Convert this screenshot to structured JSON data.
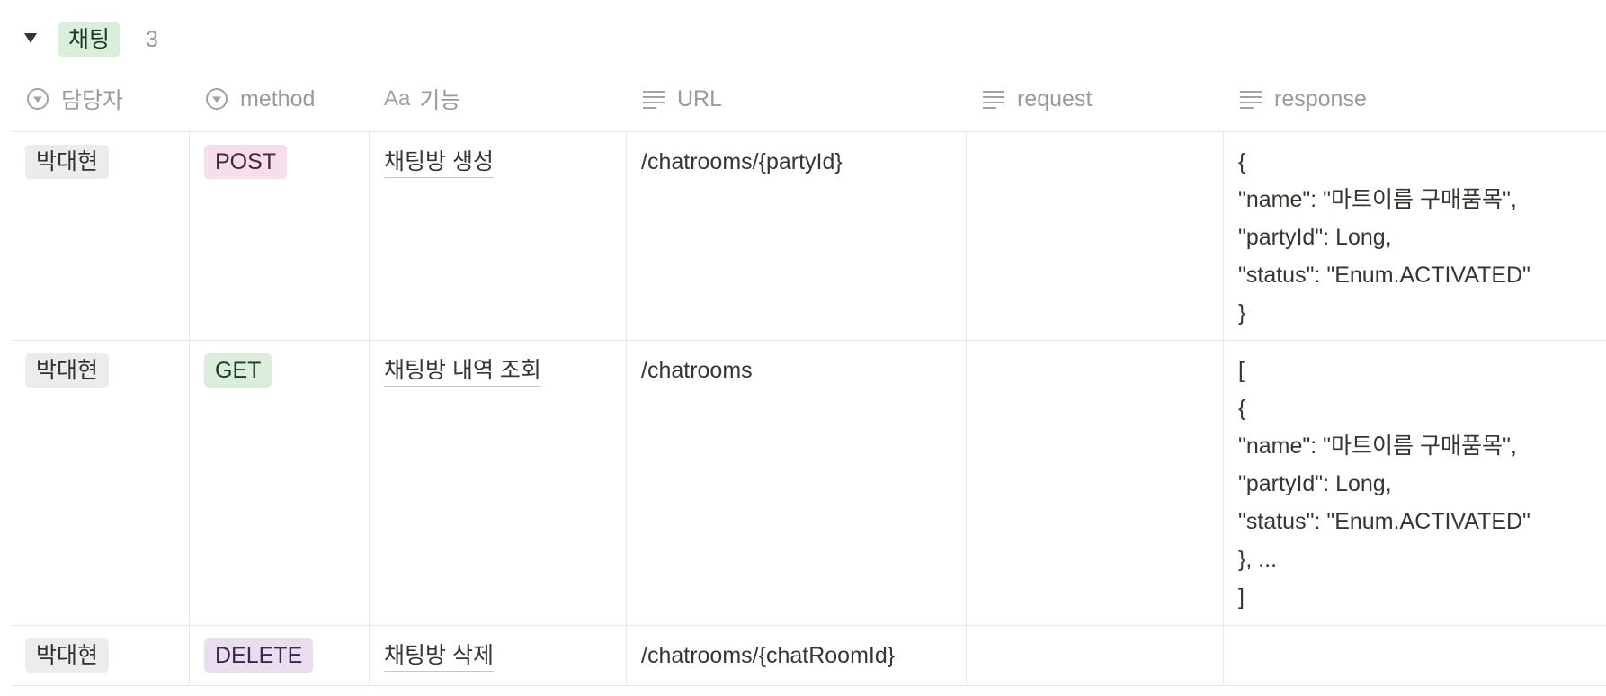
{
  "group": {
    "toggle_icon": "triangle-down-icon",
    "label": "채팅",
    "count": "3",
    "chip_color": "#dbeddb"
  },
  "columns": [
    {
      "label": "담당자",
      "icon": "select-icon"
    },
    {
      "label": "method",
      "icon": "select-icon"
    },
    {
      "label": "기능",
      "icon": "title-icon",
      "icon_text": "Aa"
    },
    {
      "label": "URL",
      "icon": "text-lines-icon"
    },
    {
      "label": "request",
      "icon": "text-lines-icon"
    },
    {
      "label": "response",
      "icon": "text-lines-icon"
    }
  ],
  "rows": [
    {
      "owner": "박대현",
      "method": "POST",
      "feature": "채팅방 생성",
      "url": "/chatrooms/{partyId}",
      "request": "",
      "response": [
        "{",
        "\"name\": \"마트이름 구매품목\",",
        "\"partyId\": Long,",
        "\"status\": \"Enum.ACTIVATED\"",
        "}"
      ]
    },
    {
      "owner": "박대현",
      "method": "GET",
      "feature": "채팅방 내역 조회",
      "url": "/chatrooms",
      "request": "",
      "response": [
        "[",
        "{",
        "\"name\": \"마트이름 구매품목\",",
        "\"partyId\": Long,",
        "\"status\": \"Enum.ACTIVATED\"",
        "}, ...",
        "]"
      ]
    },
    {
      "owner": "박대현",
      "method": "DELETE",
      "feature": "채팅방 삭제",
      "url": "/chatrooms/{chatRoomId}",
      "request": "",
      "response": []
    }
  ],
  "colors": {
    "post": "#f4dfeb",
    "get": "#dbeddb",
    "delete": "#e8deee",
    "owner": "#ececeb",
    "border": "#e9e9e7",
    "header_text": "#9b9a97"
  }
}
